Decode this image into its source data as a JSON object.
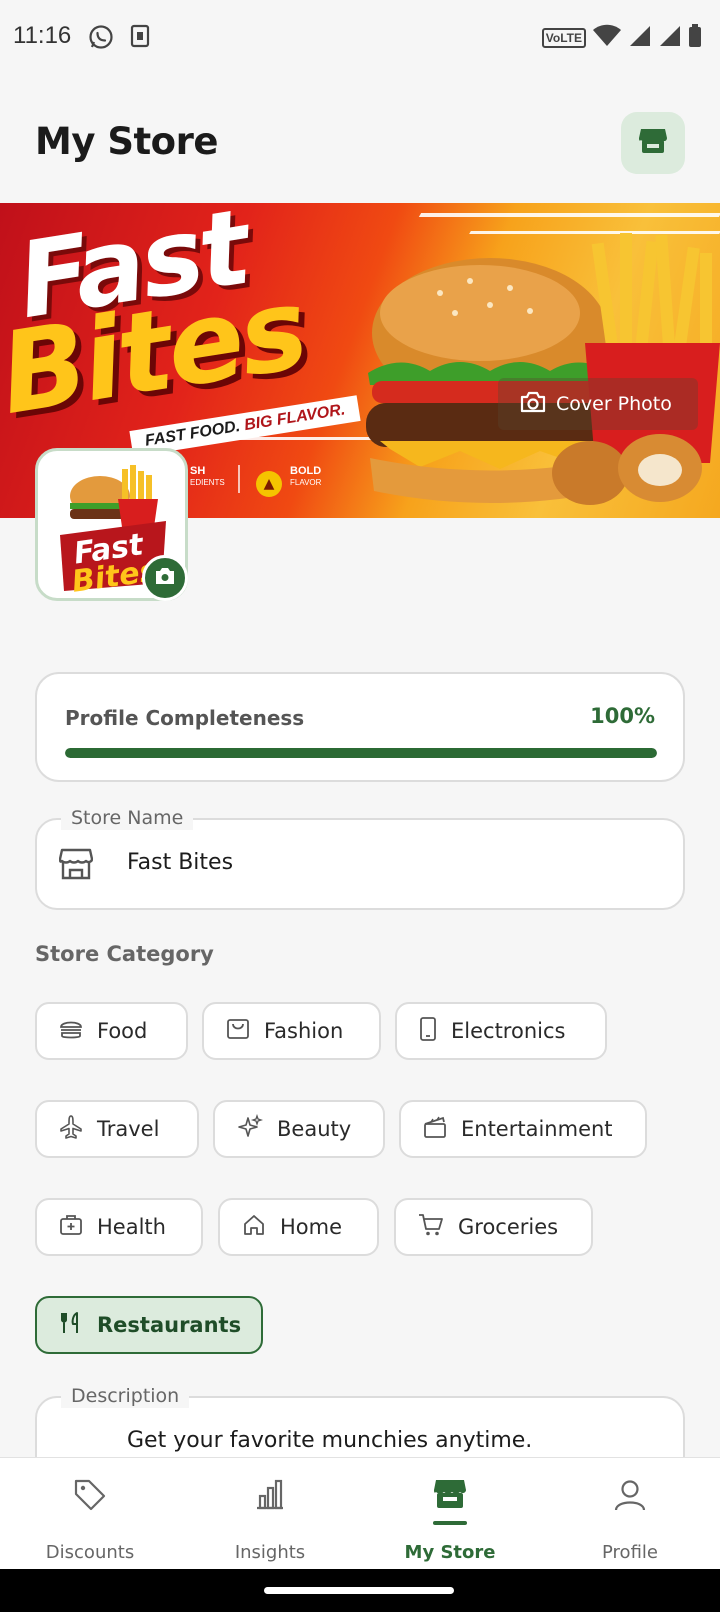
{
  "status_bar": {
    "time": "11:16",
    "network_label": "VoLTE"
  },
  "header": {
    "title": "My Store",
    "store_icon": "store-icon"
  },
  "cover": {
    "brand_line1": "Fast",
    "brand_line2": "Bites",
    "tagline_a": "FAST FOOD.",
    "tagline_b": "BIG FLAVOR.",
    "feature1_top": "SH",
    "feature1_bottom": "EDIENTS",
    "feature2_top": "BOLD",
    "feature2_bottom": "FLAVOR",
    "cover_photo_label": "Cover Photo"
  },
  "logo": {
    "line1": "Fast",
    "line2": "Bites"
  },
  "completeness": {
    "label": "Profile Completeness",
    "percent_text": "100%",
    "fraction": 1.0
  },
  "store_name": {
    "legend": "Store Name",
    "value": "Fast Bites"
  },
  "category": {
    "label": "Store Category",
    "chips": [
      {
        "label": "Food",
        "icon": "burger-icon",
        "selected": false
      },
      {
        "label": "Fashion",
        "icon": "bag-icon",
        "selected": false
      },
      {
        "label": "Electronics",
        "icon": "phone-icon",
        "selected": false
      },
      {
        "label": "Travel",
        "icon": "plane-icon",
        "selected": false
      },
      {
        "label": "Beauty",
        "icon": "sparkle-icon",
        "selected": false
      },
      {
        "label": "Entertainment",
        "icon": "clapperboard-icon",
        "selected": false
      },
      {
        "label": "Health",
        "icon": "medkit-icon",
        "selected": false
      },
      {
        "label": "Home",
        "icon": "house-icon",
        "selected": false
      },
      {
        "label": "Groceries",
        "icon": "cart-icon",
        "selected": false
      },
      {
        "label": "Restaurants",
        "icon": "utensils-icon",
        "selected": true
      }
    ]
  },
  "description": {
    "legend": "Description",
    "value": "Get your favorite munchies anytime."
  },
  "nav": {
    "items": [
      {
        "label": "Discounts",
        "icon": "tag-icon",
        "active": false
      },
      {
        "label": "Insights",
        "icon": "bar-chart-icon",
        "active": false
      },
      {
        "label": "My Store",
        "icon": "store-icon",
        "active": true
      },
      {
        "label": "Profile",
        "icon": "person-icon",
        "active": false
      }
    ]
  },
  "colors": {
    "accent": "#2e6b37",
    "accent_soft": "#dcebdd",
    "background": "#f6f6f6"
  }
}
